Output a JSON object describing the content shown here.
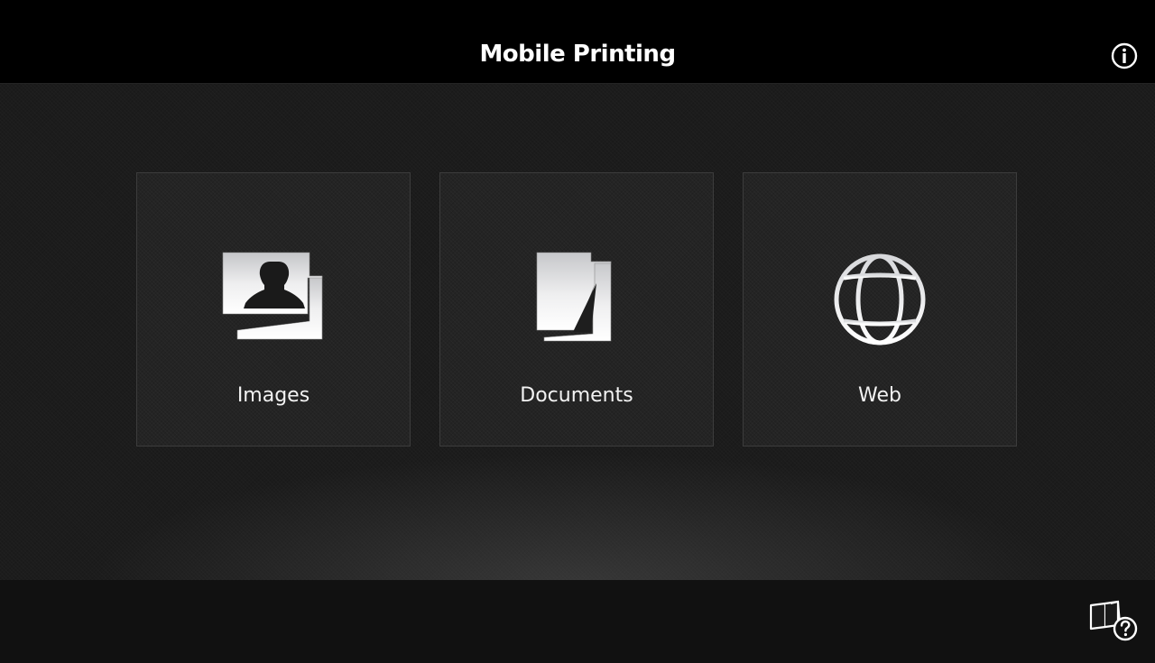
{
  "header": {
    "title": "Mobile Printing",
    "info_icon": "info-icon"
  },
  "tiles": [
    {
      "label": "Images",
      "icon": "images-icon"
    },
    {
      "label": "Documents",
      "icon": "documents-icon"
    },
    {
      "label": "Web",
      "icon": "globe-icon"
    }
  ],
  "footer": {
    "help_icon": "manual-help-icon"
  },
  "colors": {
    "topbar": "#000000",
    "background": "#1c1c1c",
    "tile": "#242424",
    "tile_border": "#3c3c3c",
    "text": "#ffffff",
    "footer": "#111111"
  }
}
